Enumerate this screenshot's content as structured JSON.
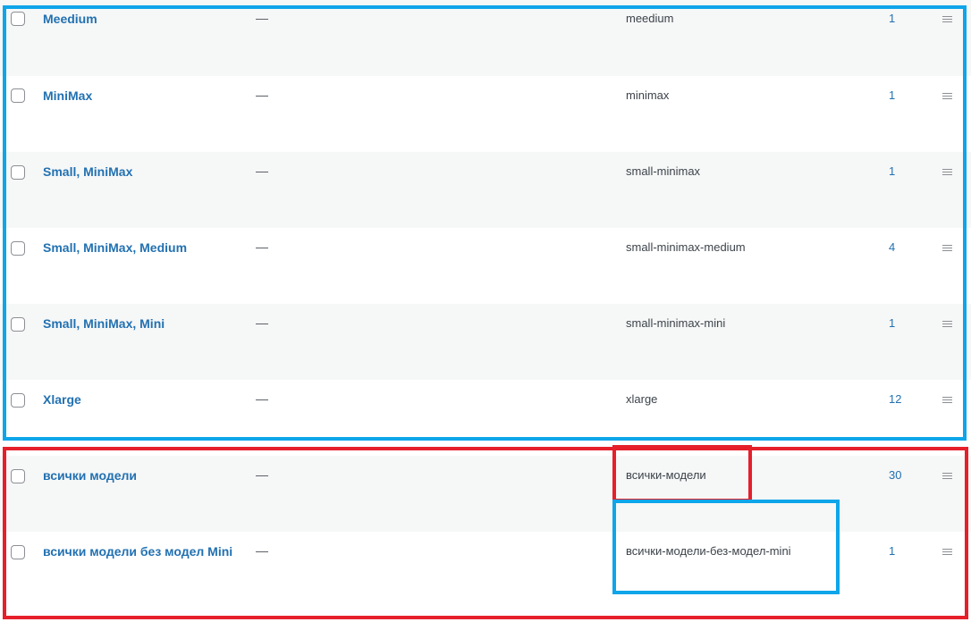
{
  "table": {
    "rows": [
      {
        "name": "Meedium",
        "description": "—",
        "slug": "meedium",
        "count": "1"
      },
      {
        "name": "MiniMax",
        "description": "—",
        "slug": "minimax",
        "count": "1"
      },
      {
        "name": "Small, MiniMax",
        "description": "—",
        "slug": "small-minimax",
        "count": "1"
      },
      {
        "name": "Small, MiniMax, Medium",
        "description": "—",
        "slug": "small-minimax-medium",
        "count": "4"
      },
      {
        "name": "Small, MiniMax, Mini",
        "description": "—",
        "slug": "small-minimax-mini",
        "count": "1"
      },
      {
        "name": "Xlarge",
        "description": "—",
        "slug": "xlarge",
        "count": "12"
      },
      {
        "name": "всички модели",
        "description": "—",
        "slug": "всички-модели",
        "count": "30"
      },
      {
        "name": "всички модели без модел Mini",
        "description": "—",
        "slug": "всички-модели-без-модел-mini",
        "count": "1"
      }
    ]
  },
  "annotations": {
    "colors": {
      "blue": "#0ea5e9",
      "red": "#e5202a"
    }
  },
  "icons": {
    "checkbox": "checkbox-icon",
    "drag_handle": "drag-handle-icon"
  }
}
